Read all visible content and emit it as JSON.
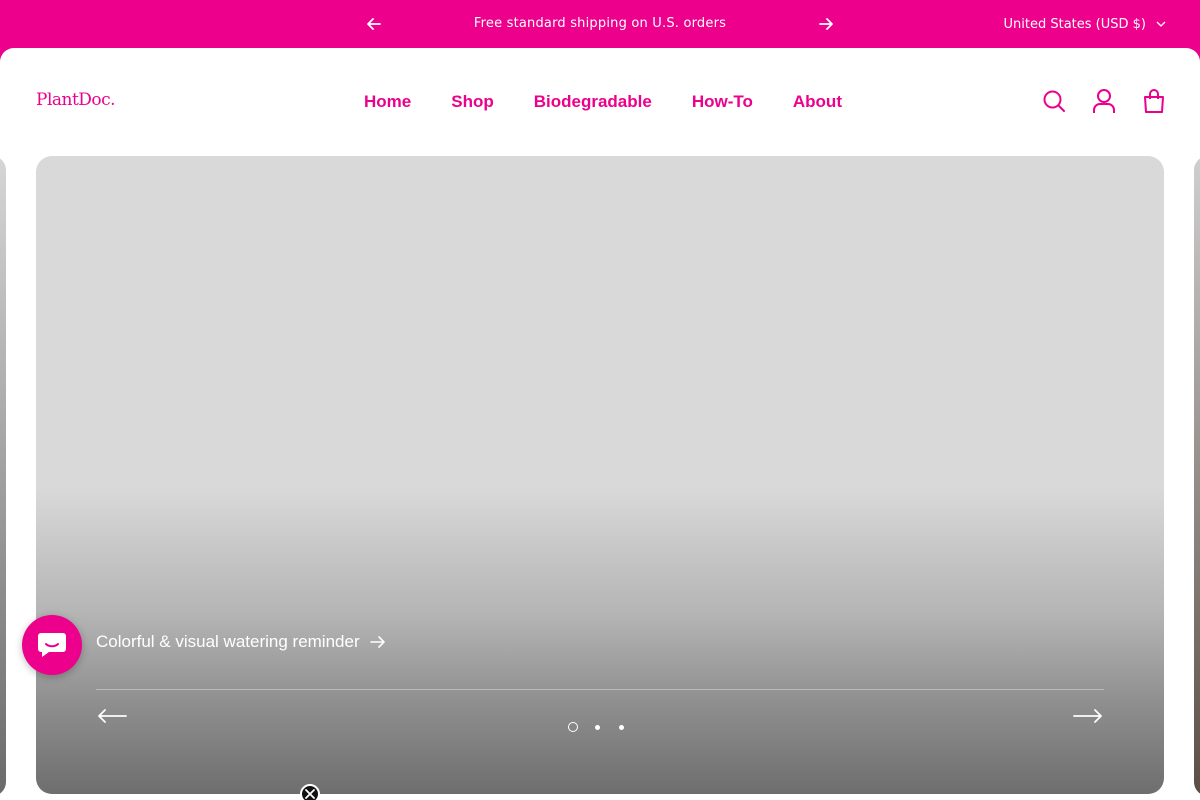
{
  "announcement": {
    "message": "Free standard shipping on U.S. orders",
    "country": "United States (USD $)"
  },
  "header": {
    "logo": "PlantDoc.",
    "nav": [
      {
        "label": "Home"
      },
      {
        "label": "Shop"
      },
      {
        "label": "Biodegradable"
      },
      {
        "label": "How-To"
      },
      {
        "label": "About"
      }
    ],
    "icons": [
      "search-icon",
      "account-icon",
      "cart-icon"
    ]
  },
  "slideshow": {
    "caption": "Colorful & visual watering reminder",
    "slide_count": 3,
    "active_slide": 1
  },
  "colors": {
    "brand": "#ec008c",
    "slide_bg": "#d9d9d9",
    "white": "#ffffff"
  }
}
